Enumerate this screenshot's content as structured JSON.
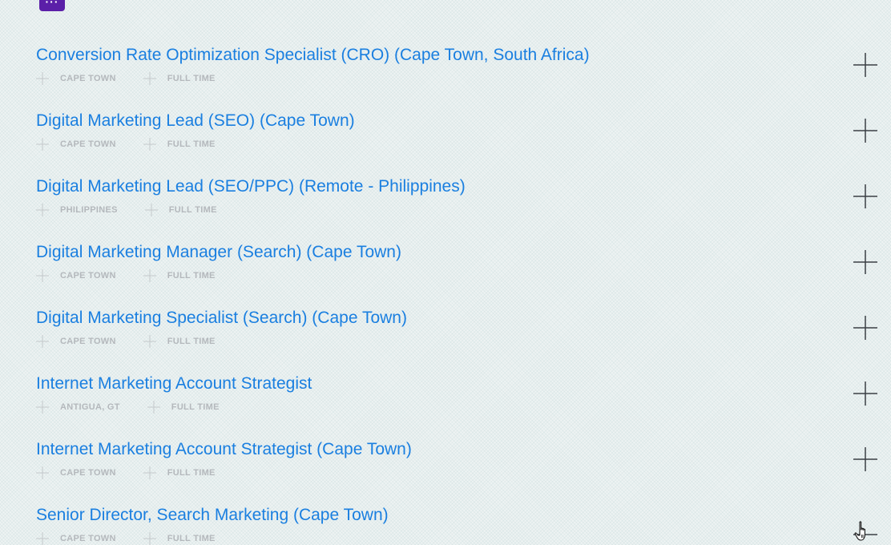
{
  "menu": {
    "label": "···"
  },
  "jobs": [
    {
      "title": "Conversion Rate Optimization Specialist (CRO) (Cape Town, South Africa)",
      "location": "CAPE TOWN",
      "type": "FULL TIME",
      "expanded": false
    },
    {
      "title": "Digital Marketing Lead (SEO) (Cape Town)",
      "location": "CAPE TOWN",
      "type": "FULL TIME",
      "expanded": false
    },
    {
      "title": "Digital Marketing Lead (SEO/PPC) (Remote - Philippines)",
      "location": "PHILIPPINES",
      "type": "FULL TIME",
      "expanded": false
    },
    {
      "title": "Digital Marketing Manager (Search) (Cape Town)",
      "location": "CAPE TOWN",
      "type": "FULL TIME",
      "expanded": false
    },
    {
      "title": "Digital Marketing Specialist (Search) (Cape Town)",
      "location": "CAPE TOWN",
      "type": "FULL TIME",
      "expanded": false
    },
    {
      "title": "Internet Marketing Account Strategist",
      "location": "ANTIGUA, GT",
      "type": "FULL TIME",
      "expanded": false
    },
    {
      "title": "Internet Marketing Account Strategist (Cape Town)",
      "location": "CAPE TOWN",
      "type": "FULL TIME",
      "expanded": false
    },
    {
      "title": "Senior Director, Search Marketing (Cape Town)",
      "location": "CAPE TOWN",
      "type": "FULL TIME",
      "expanded": true
    }
  ],
  "icons": {
    "meta": "plus-icon",
    "toggle_collapsed": "plus-icon",
    "toggle_expanded": "minus-icon",
    "cursor": "hand-cursor-icon"
  },
  "colors": {
    "title": "#1a7fe0",
    "meta_text": "#b4b8bc",
    "meta_icon": "#c4c8cb",
    "toggle": "#3a3f44",
    "menu_bg": "#5b1fa8",
    "background": "#eef3f3"
  }
}
